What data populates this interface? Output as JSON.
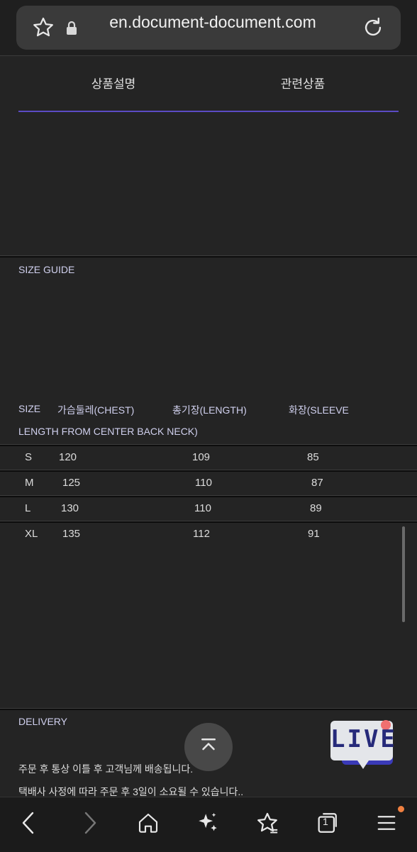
{
  "browser": {
    "url": "en.document-document.com"
  },
  "tabs": [
    {
      "label": "상품설명"
    },
    {
      "label": "관련상품"
    }
  ],
  "size_guide": {
    "title": "SIZE GUIDE",
    "header_line1": [
      "SIZE",
      "가슴둘레(CHEST)",
      "총기장(LENGTH)",
      "화장(SLEEVE"
    ],
    "header_line2": "LENGTH FROM CENTER BACK NECK)",
    "rows": [
      {
        "size": "S",
        "chest": "120",
        "length": "109",
        "sleeve": "85"
      },
      {
        "size": "M",
        "chest": "125",
        "length": "110",
        "sleeve": "87"
      },
      {
        "size": "L",
        "chest": "130",
        "length": "110",
        "sleeve": "89"
      },
      {
        "size": "XL",
        "chest": "135",
        "length": "112",
        "sleeve": "91"
      }
    ]
  },
  "delivery": {
    "title": "DELIVERY",
    "line1": "주문 후  통상 이틀 후 고객님께 배송됩니다.",
    "line2": "택배사 사정에 따라 주문 후 3일이 소요될 수 있습니다.."
  },
  "live_badge": {
    "text": "LIVE"
  },
  "bottom_nav": {
    "tab_count": "1"
  },
  "colors": {
    "accent": "#5b4bc4",
    "live_dot": "#f07070",
    "notification_dot": "#f08040"
  },
  "icons": [
    "star-icon",
    "lock-icon",
    "reload-icon",
    "back-icon",
    "forward-icon",
    "home-icon",
    "sparkle-icon",
    "favorites-icon",
    "tabs-icon",
    "menu-icon",
    "chevron-up-icon"
  ]
}
